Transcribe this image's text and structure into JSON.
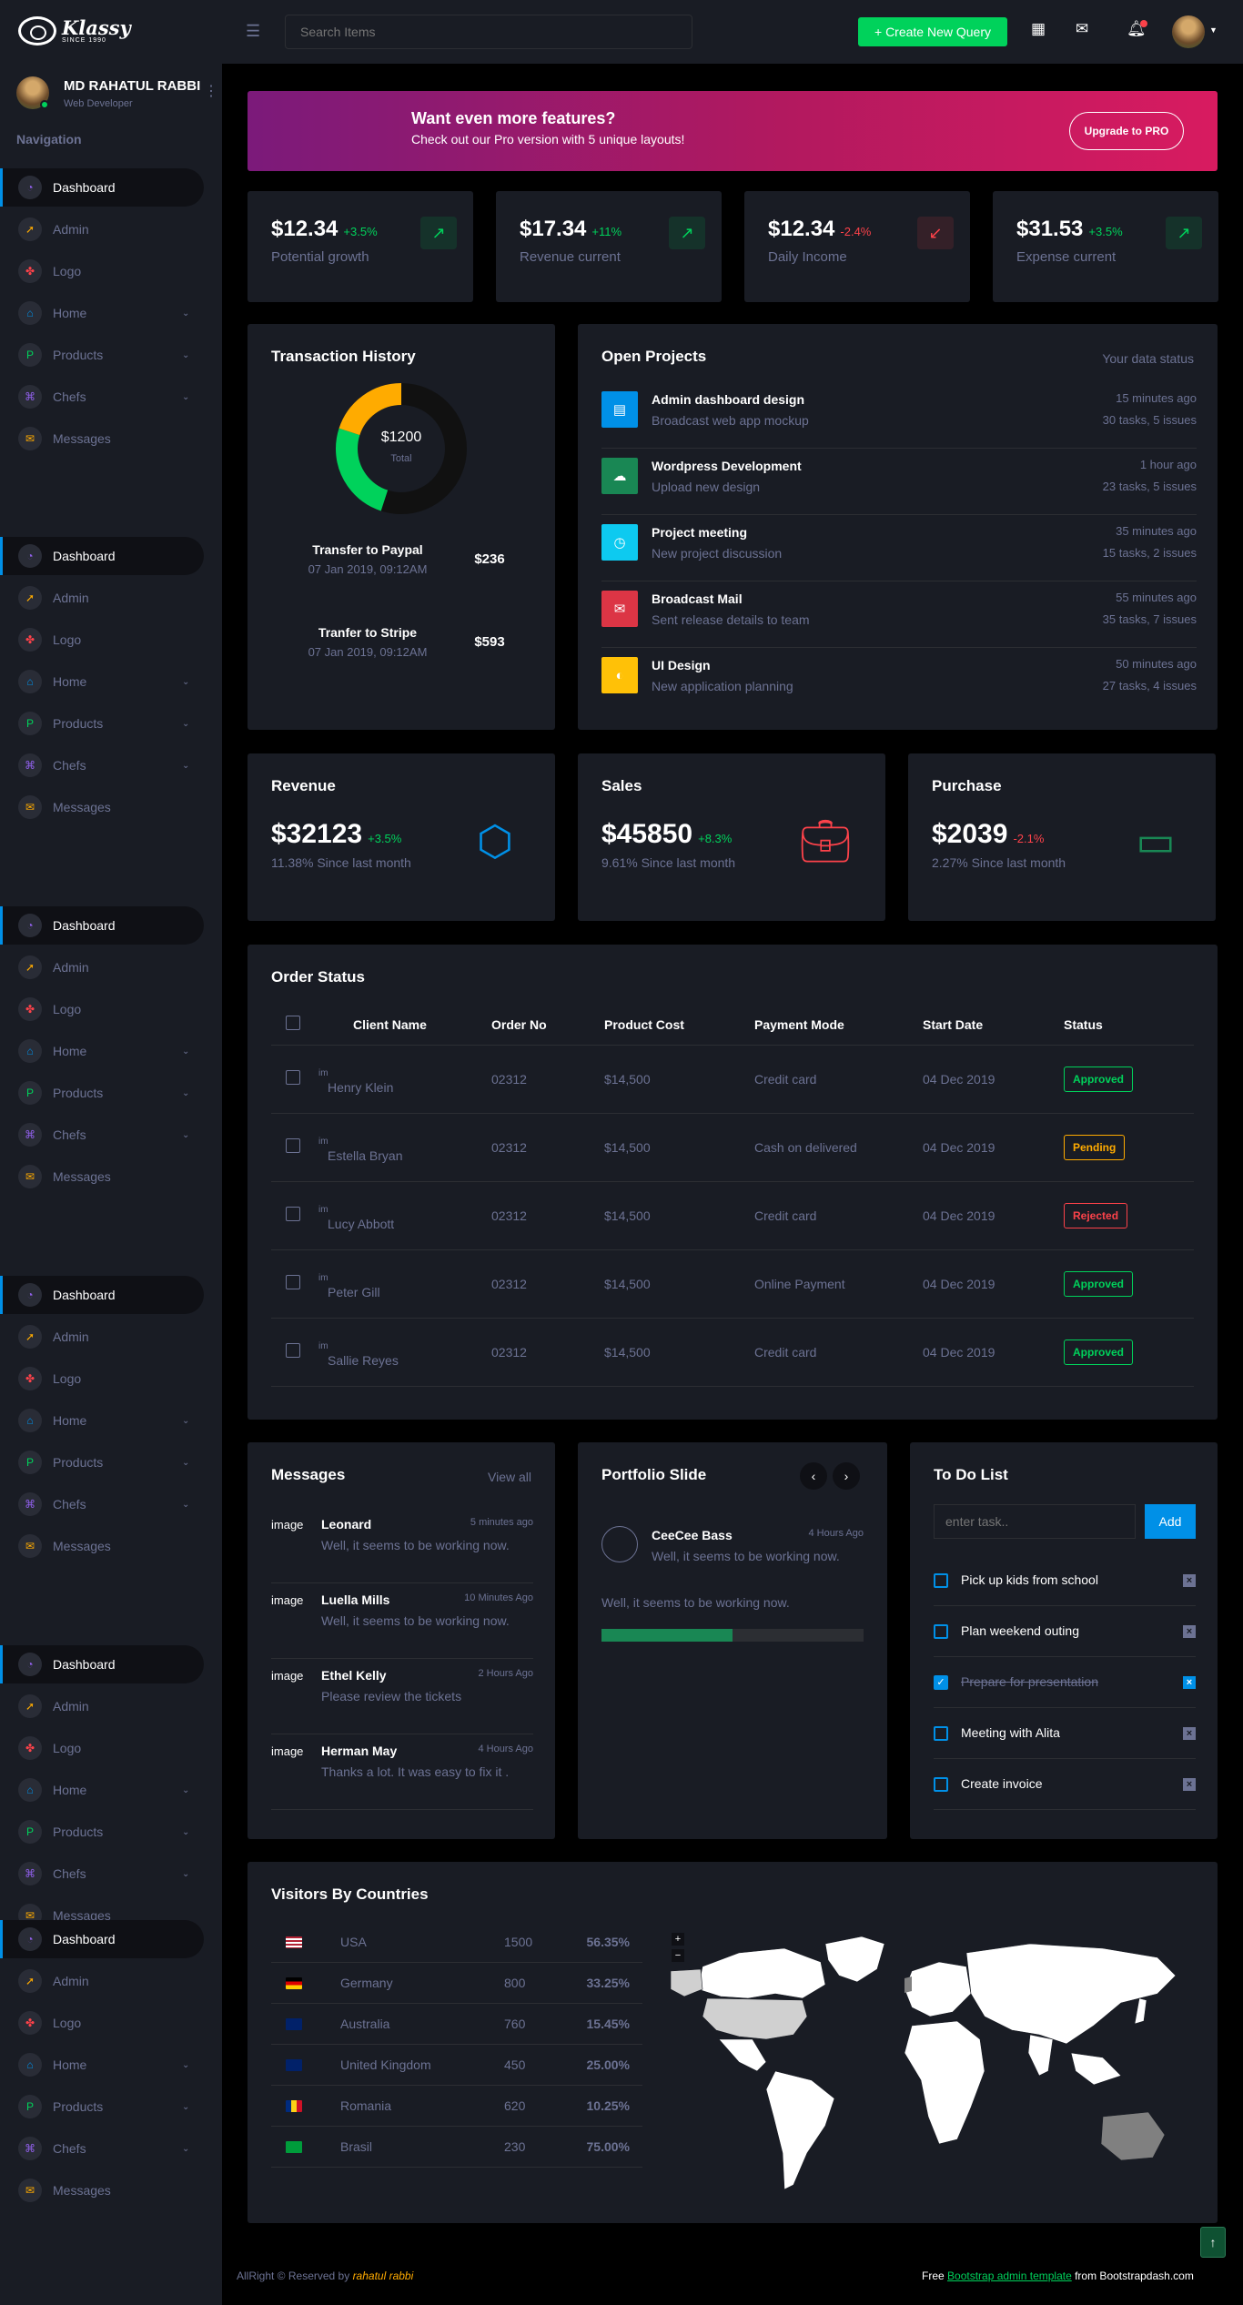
{
  "brand": {
    "name": "Klassy",
    "since": "SINCE 1990"
  },
  "topbar": {
    "search_placeholder": "Search Items",
    "create_label": "+ Create New Query"
  },
  "profile": {
    "name": "MD RAHATUL RABBI",
    "role": "Web Developer"
  },
  "nav": {
    "heading": "Navigation",
    "items": [
      {
        "label": "Dashboard",
        "icon": "speedometer-icon",
        "color": "#8f5fe8"
      },
      {
        "label": "Admin",
        "icon": "rocket-icon",
        "color": "#ffab00"
      },
      {
        "label": "Logo",
        "icon": "fan-icon",
        "color": "#fc424a"
      },
      {
        "label": "Home",
        "icon": "home-icon",
        "color": "#0090e7"
      },
      {
        "label": "Products",
        "icon": "paypal-icon",
        "color": "#00d25b"
      },
      {
        "label": "Chefs",
        "icon": "command-icon",
        "color": "#8f5fe8"
      },
      {
        "label": "Messages",
        "icon": "email-icon",
        "color": "#ffab00"
      }
    ]
  },
  "banner": {
    "title": "Want even more features?",
    "subtitle": "Check out our Pro version with 5 unique layouts!",
    "button": "Upgrade to PRO"
  },
  "stats": [
    {
      "value": "$12.34",
      "change": "+3.5%",
      "label": "Potential growth",
      "trend": "up"
    },
    {
      "value": "$17.34",
      "change": "+11%",
      "label": "Revenue current",
      "trend": "up"
    },
    {
      "value": "$12.34",
      "change": "-2.4%",
      "label": "Daily Income",
      "trend": "down"
    },
    {
      "value": "$31.53",
      "change": "+3.5%",
      "label": "Expense current",
      "trend": "up"
    }
  ],
  "transactions": {
    "title": "Transaction History",
    "donut_center": "$1200",
    "donut_sub": "Total",
    "chart_data": {
      "type": "pie",
      "values": [
        55,
        25,
        20
      ],
      "colors": [
        "#111111",
        "#00d25b",
        "#ffab00"
      ]
    },
    "items": [
      {
        "title": "Transfer to Paypal",
        "date": "07 Jan 2019, 09:12AM",
        "amount": "$236"
      },
      {
        "title": "Tranfer to Stripe",
        "date": "07 Jan 2019, 09:12AM",
        "amount": "$593"
      }
    ]
  },
  "projects": {
    "title": "Open Projects",
    "status_label": "Your data status",
    "items": [
      {
        "title": "Admin dashboard design",
        "sub": "Broadcast web app mockup",
        "time": "15 minutes ago",
        "tasks": "30 tasks, 5 issues",
        "color": "#0090e7",
        "icon": "file-icon"
      },
      {
        "title": "Wordpress Development",
        "sub": "Upload new design",
        "time": "1 hour ago",
        "tasks": "23 tasks, 5 issues",
        "color": "#198754",
        "icon": "cloud-upload-icon"
      },
      {
        "title": "Project meeting",
        "sub": "New project discussion",
        "time": "35 minutes ago",
        "tasks": "15 tasks, 2 issues",
        "color": "#0dcaf0",
        "icon": "clock-icon"
      },
      {
        "title": "Broadcast Mail",
        "sub": "Sent release details to team",
        "time": "55 minutes ago",
        "tasks": "35 tasks, 7 issues",
        "color": "#dc3545",
        "icon": "mail-open-icon"
      },
      {
        "title": "UI Design",
        "sub": "New application planning",
        "time": "50 minutes ago",
        "tasks": "27 tasks, 4 issues",
        "color": "#ffc107",
        "icon": "palette-icon"
      }
    ]
  },
  "summary": [
    {
      "title": "Revenue",
      "value": "$32123",
      "change": "+3.5%",
      "sub": "11.38% Since last month",
      "trend": "up",
      "icon": "codepen-icon",
      "color": "#0090e7"
    },
    {
      "title": "Sales",
      "value": "$45850",
      "change": "+8.3%",
      "sub": "9.61% Since last month",
      "trend": "up",
      "icon": "briefcase-icon",
      "color": "#fc424a"
    },
    {
      "title": "Purchase",
      "value": "$2039",
      "change": "-2.1%",
      "sub": "2.27% Since last month",
      "trend": "down",
      "icon": "monitor-icon",
      "color": "#198754"
    }
  ],
  "orders": {
    "title": "Order Status",
    "headers": [
      "Client Name",
      "Order No",
      "Product Cost",
      "Payment Mode",
      "Start Date",
      "Status"
    ],
    "img_alt": "im",
    "rows": [
      {
        "client": "Henry Klein",
        "order": "02312",
        "cost": "$14,500",
        "payment": "Credit card",
        "date": "04 Dec 2019",
        "status": "Approved",
        "kind": "ok"
      },
      {
        "client": "Estella Bryan",
        "order": "02312",
        "cost": "$14,500",
        "payment": "Cash on delivered",
        "date": "04 Dec 2019",
        "status": "Pending",
        "kind": "pending"
      },
      {
        "client": "Lucy Abbott",
        "order": "02312",
        "cost": "$14,500",
        "payment": "Credit card",
        "date": "04 Dec 2019",
        "status": "Rejected",
        "kind": "rej"
      },
      {
        "client": "Peter Gill",
        "order": "02312",
        "cost": "$14,500",
        "payment": "Online Payment",
        "date": "04 Dec 2019",
        "status": "Approved",
        "kind": "ok"
      },
      {
        "client": "Sallie Reyes",
        "order": "02312",
        "cost": "$14,500",
        "payment": "Credit card",
        "date": "04 Dec 2019",
        "status": "Approved",
        "kind": "ok"
      }
    ]
  },
  "messages": {
    "title": "Messages",
    "view_all": "View all",
    "img_alt": "image",
    "items": [
      {
        "name": "Leonard",
        "time": "5 minutes ago",
        "text": "Well, it seems to be working now."
      },
      {
        "name": "Luella Mills",
        "time": "10 Minutes Ago",
        "text": "Well, it seems to be working now."
      },
      {
        "name": "Ethel Kelly",
        "time": "2 Hours Ago",
        "text": "Please review the tickets"
      },
      {
        "name": "Herman May",
        "time": "4 Hours Ago",
        "text": "Thanks a lot. It was easy to fix it ."
      }
    ]
  },
  "portfolio": {
    "title": "Portfolio Slide",
    "name": "CeeCee Bass",
    "time": "4 Hours Ago",
    "line1": "Well, it seems to be working now.",
    "text": "Well, it seems to be working now.",
    "progress": 0.5
  },
  "todo": {
    "title": "To Do List",
    "placeholder": "enter task..",
    "add_label": "Add",
    "items": [
      {
        "text": "Pick up kids from school",
        "done": false
      },
      {
        "text": "Plan weekend outing",
        "done": false
      },
      {
        "text": "Prepare for presentation",
        "done": true
      },
      {
        "text": "Meeting with Alita",
        "done": false
      },
      {
        "text": "Create invoice",
        "done": false
      }
    ]
  },
  "visitors": {
    "title": "Visitors By Countries",
    "rows": [
      {
        "country": "USA",
        "count": "1500",
        "pct": "56.35%",
        "flag": "us"
      },
      {
        "country": "Germany",
        "count": "800",
        "pct": "33.25%",
        "flag": "de"
      },
      {
        "country": "Australia",
        "count": "760",
        "pct": "15.45%",
        "flag": "au"
      },
      {
        "country": "United Kingdom",
        "count": "450",
        "pct": "25.00%",
        "flag": "gb"
      },
      {
        "country": "Romania",
        "count": "620",
        "pct": "10.25%",
        "flag": "ro"
      },
      {
        "country": "Brasil",
        "count": "230",
        "pct": "75.00%",
        "flag": "br"
      }
    ],
    "zoom_in": "+",
    "zoom_out": "−"
  },
  "footer": {
    "left_prefix": "AllRight © Reserved by ",
    "left_author": "rahatul rabbi",
    "right_prefix": "Free ",
    "right_link": "Bootstrap admin template",
    "right_suffix": " from Bootstrapdash.com"
  }
}
